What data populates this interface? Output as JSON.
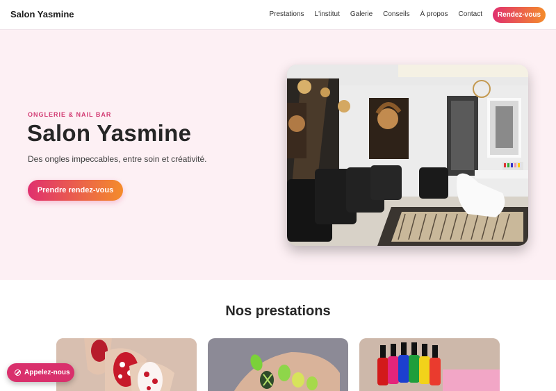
{
  "header": {
    "brand": "Salon Yasmine",
    "nav": [
      "Prestations",
      "L'institut",
      "Galerie",
      "Conseils",
      "À propos",
      "Contact"
    ],
    "cta_label": "Rendez-vous"
  },
  "hero": {
    "eyebrow": "ONGLERIE & NAIL BAR",
    "title": "Salon Yasmine",
    "subtitle": "Des ongles impeccables, entre soin et créativité.",
    "cta_label": "Prendre rendez-vous",
    "image_icon": "salon-interior-photo"
  },
  "services": {
    "title": "Nos prestations"
  },
  "call_button": {
    "label": "Appelez-nous",
    "icon": "phone-icon"
  },
  "colors": {
    "accent_pink": "#e0306f",
    "accent_orange": "#f48c2b",
    "hero_bg": "#fdf0f4"
  }
}
